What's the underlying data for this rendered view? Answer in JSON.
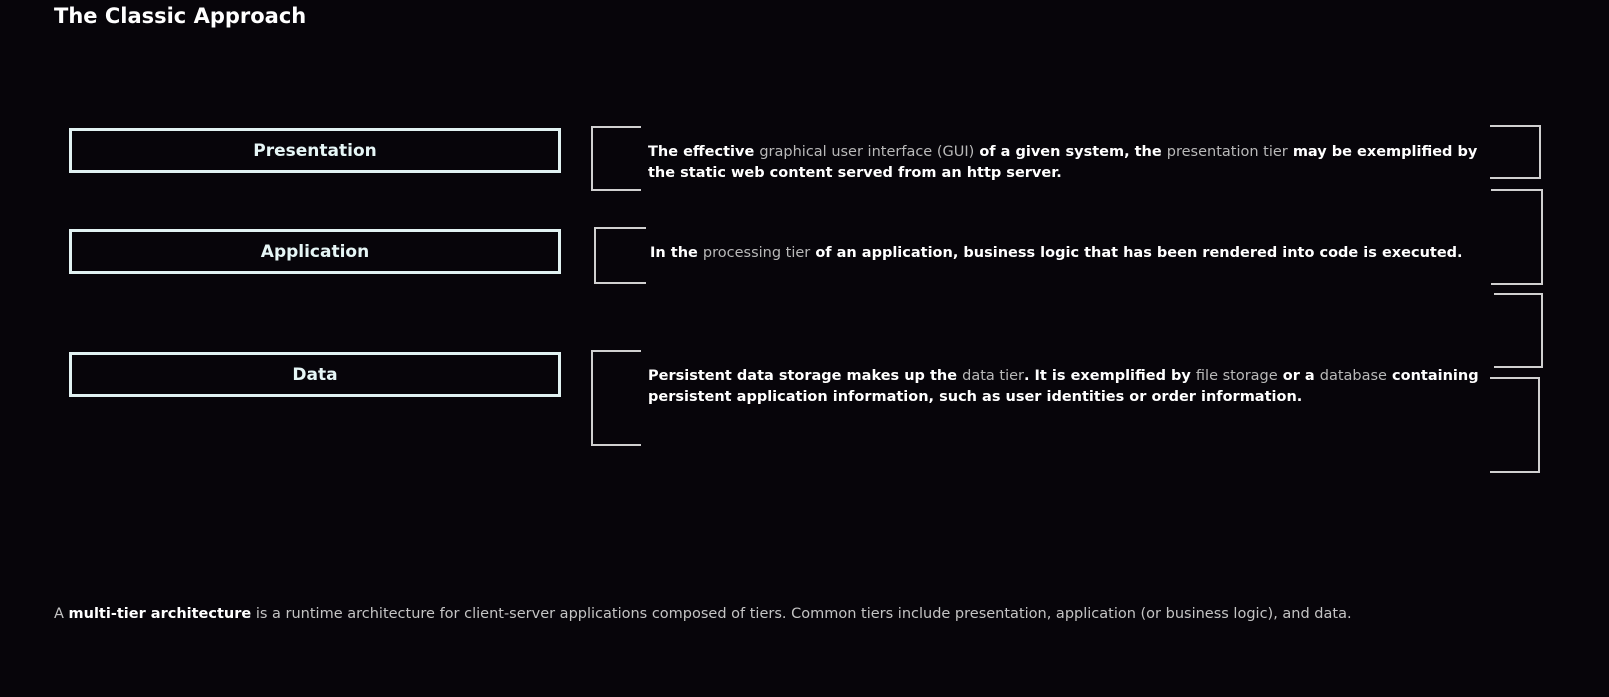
{
  "title": "The Classic Approach",
  "tiers": [
    {
      "label": "Presentation",
      "desc_1": "The effective ",
      "term_1": "graphical user interface (GUI)",
      "desc_2": " of a given system, the ",
      "term_2": "presentation tier",
      "desc_3": " may be exemplified by the static web content served from an http server."
    },
    {
      "label": "Application",
      "desc_1": "In the ",
      "term_1": "processing tier",
      "desc_2": " of an application, business logic that has been rendered into code is executed."
    },
    {
      "label": "Data",
      "desc_1": "Persistent data storage makes up the ",
      "term_1": "data tier",
      "desc_2": ".  It is exemplified by ",
      "term_2": "file storage",
      "desc_3": " or a ",
      "term_3": "database",
      "desc_4": " containing persistent application information, such as user identities or order information."
    }
  ],
  "footer": {
    "prefix": "A ",
    "strong": "multi-tier architecture",
    "rest": " is a runtime architecture for client-server applications composed of tiers.  Common tiers include presentation, application (or business logic), and data."
  },
  "colors": {
    "background": "#07050a",
    "box_border": "#e1f2f2",
    "term_text": "#b9b9b9"
  }
}
